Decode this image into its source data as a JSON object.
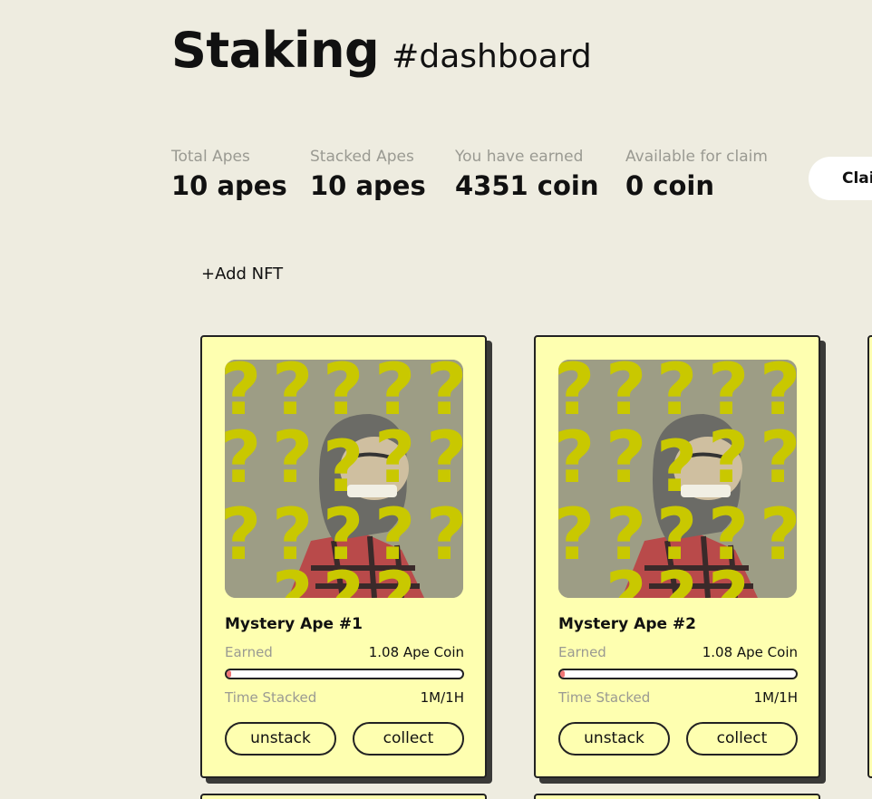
{
  "header": {
    "title": "Staking",
    "subtitle": "#dashboard"
  },
  "stats": [
    {
      "label": "Total Apes",
      "value": "10 apes"
    },
    {
      "label": "Stacked Apes",
      "value": "10 apes"
    },
    {
      "label": "You have earned",
      "value": "4351 coin"
    },
    {
      "label": "Available for claim",
      "value": "0 coin"
    }
  ],
  "claim_button": "Clai",
  "add_nft": "+Add NFT",
  "cards": [
    {
      "name": "Mystery Ape #1",
      "earned_label": "Earned",
      "earned_value": "1.08 Ape Coin",
      "progress": 0.02,
      "time_label": "Time Stacked",
      "time_value": "1M/1H",
      "unstack_label": "unstack",
      "collect_label": "collect"
    },
    {
      "name": "Mystery Ape #2",
      "earned_label": "Earned",
      "earned_value": "1.08 Ape Coin",
      "progress": 0.02,
      "time_label": "Time Stacked",
      "time_value": "1M/1H",
      "unstack_label": "unstack",
      "collect_label": "collect"
    }
  ],
  "colors": {
    "background": "#eeece0",
    "card": "#feffb0",
    "question_marks": "#c9c800",
    "progress_fill": "#f07575"
  }
}
